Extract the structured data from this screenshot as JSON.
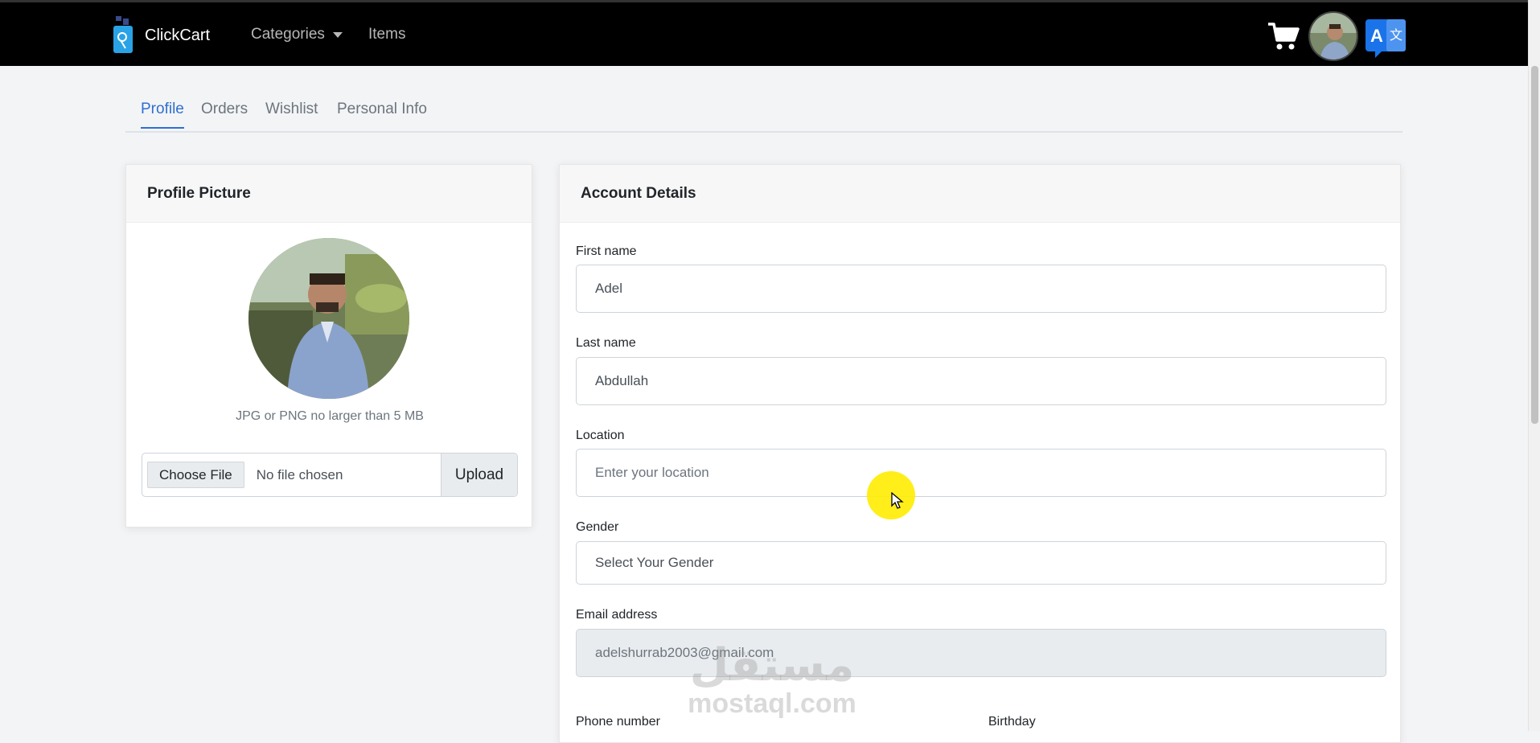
{
  "navbar": {
    "brand": "ClickCart",
    "links": [
      {
        "label": "Categories",
        "has_dropdown": true
      },
      {
        "label": "Items",
        "has_dropdown": false
      }
    ],
    "icons": [
      "cart-icon",
      "user-avatar",
      "translate-icon"
    ]
  },
  "tabs": [
    {
      "label": "Profile",
      "active": true
    },
    {
      "label": "Orders",
      "active": false
    },
    {
      "label": "Wishlist",
      "active": false
    },
    {
      "label": "Personal Info",
      "active": false
    }
  ],
  "profile_picture": {
    "title": "Profile Picture",
    "hint": "JPG or PNG no larger than 5 MB",
    "choose_label": "Choose File",
    "no_file_label": "No file chosen",
    "upload_label": "Upload"
  },
  "account": {
    "title": "Account Details",
    "first_name": {
      "label": "First name",
      "value": "Adel"
    },
    "last_name": {
      "label": "Last name",
      "value": "Abdullah"
    },
    "location": {
      "label": "Location",
      "placeholder": "Enter your location"
    },
    "gender": {
      "label": "Gender",
      "value": "Select Your Gender"
    },
    "email": {
      "label": "Email address",
      "value": "adelshurrab2003@gmail.com"
    },
    "phone": {
      "label": "Phone number"
    },
    "birthday": {
      "label": "Birthday"
    }
  },
  "watermark": {
    "arabic": "مستقل",
    "latin": "mostaql.com"
  },
  "colors": {
    "navbar": "#000000",
    "accent": "#2e6fd1",
    "background": "#f3f4f6",
    "highlight": "#ffec00"
  }
}
